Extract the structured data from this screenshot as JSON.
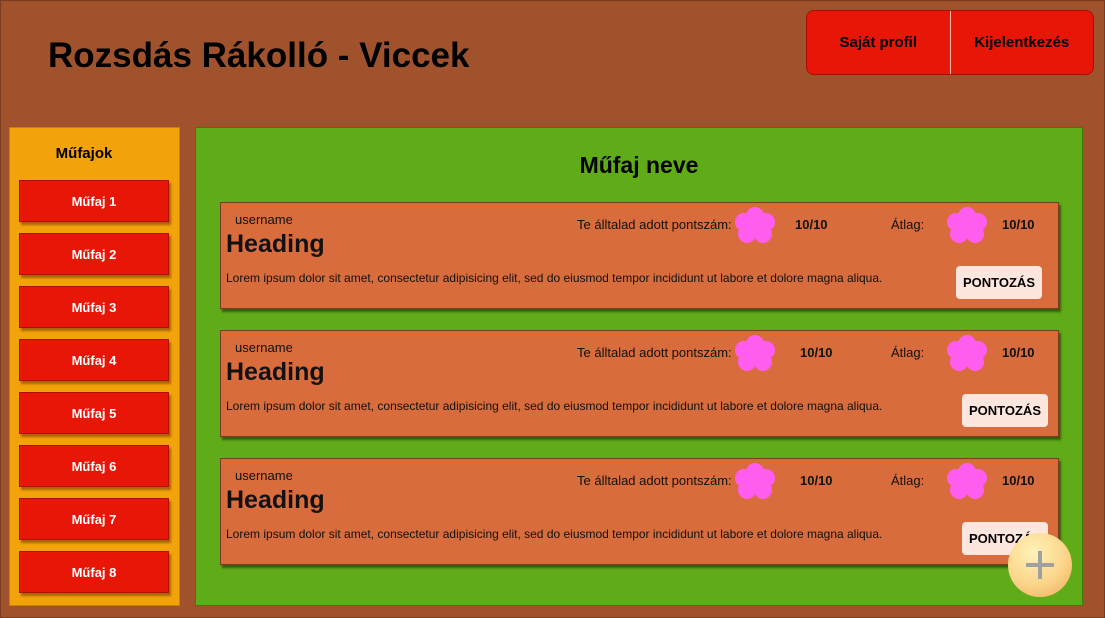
{
  "header": {
    "site_title": "Rozsdás Rákolló - Viccek",
    "profile_label": "Saját profil",
    "logout_label": "Kijelentkezés"
  },
  "sidebar": {
    "title": "Műfajok",
    "items": [
      {
        "label": "Műfaj 1"
      },
      {
        "label": "Műfaj 2"
      },
      {
        "label": "Műfaj 3"
      },
      {
        "label": "Műfaj 4"
      },
      {
        "label": "Műfaj 5"
      },
      {
        "label": "Műfaj 6"
      },
      {
        "label": "Műfaj 7"
      },
      {
        "label": "Műfaj 8"
      }
    ]
  },
  "main": {
    "title": "Műfaj neve",
    "cards": [
      {
        "username": "username",
        "heading": "Heading",
        "own_rating_label": "Te álltalad adott pontszám:",
        "own_rating": "10/10",
        "avg_label": "Átlag:",
        "avg_rating": "10/10",
        "body": "Lorem ipsum dolor sit amet, consectetur adipisicing elit, sed do eiusmod tempor incididunt ut labore et dolore magna aliqua.",
        "rate_label": "PONTOZÁS"
      },
      {
        "username": "username",
        "heading": "Heading",
        "own_rating_label": "Te álltalad adott pontszám:",
        "own_rating": "10/10",
        "avg_label": "Átlag:",
        "avg_rating": "10/10",
        "body": "Lorem ipsum dolor sit amet, consectetur adipisicing elit, sed do eiusmod tempor incididunt ut labore et dolore magna aliqua.",
        "rate_label": "PONTOZÁS"
      },
      {
        "username": "username",
        "heading": "Heading",
        "own_rating_label": "Te álltalad adott pontszám:",
        "own_rating": "10/10",
        "avg_label": "Átlag:",
        "avg_rating": "10/10",
        "body": "Lorem ipsum dolor sit amet, consectetur adipisicing elit, sed do eiusmod tempor incididunt ut labore et dolore magna aliqua.",
        "rate_label": "PONTOZÁS"
      }
    ]
  },
  "fab": {
    "icon": "plus-icon"
  },
  "colors": {
    "background": "#a0522d",
    "accent_red": "#e81607",
    "sidebar": "#f2a30a",
    "main": "#5fab18",
    "card": "#d96c3c",
    "flower": "#ff5cf0"
  }
}
